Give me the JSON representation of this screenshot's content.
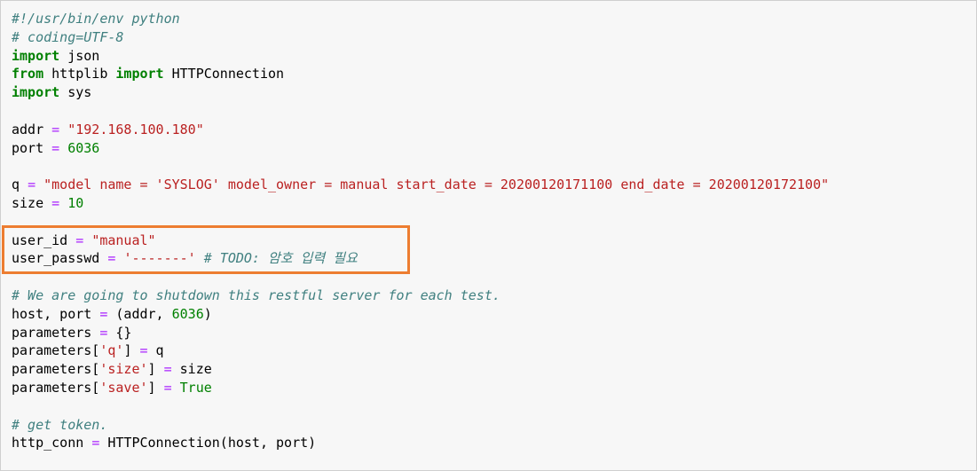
{
  "highlight": {
    "color": "#ed7d31",
    "lines": [
      11,
      12
    ]
  },
  "code": {
    "l1": {
      "c": "#!/usr/bin/env python"
    },
    "l2": {
      "c": "# coding=UTF-8"
    },
    "l3": {
      "k": "import",
      "t": " json"
    },
    "l4": {
      "k1": "from",
      "t1": " httplib ",
      "k2": "import",
      "t2": " HTTPConnection"
    },
    "l5": {
      "k": "import",
      "t": " sys"
    },
    "l7": {
      "t": "addr ",
      "o": "=",
      "sp": " ",
      "s": "\"192.168.100.180\""
    },
    "l8": {
      "t": "port ",
      "o": "=",
      "sp": " ",
      "n": "6036"
    },
    "l10": {
      "t": "q ",
      "o": "=",
      "sp": " ",
      "s": "\"model name = 'SYSLOG' model_owner = manual start_date = 20200120171100 end_date = 20200120172100\""
    },
    "l11": {
      "t": "size ",
      "o": "=",
      "sp": " ",
      "n": "10"
    },
    "l13": {
      "t": "user_id ",
      "o": "=",
      "sp": " ",
      "s": "\"manual\""
    },
    "l14": {
      "t": "user_passwd ",
      "o": "=",
      "sp": " ",
      "s": "'-------'",
      "sp2": " ",
      "c": "# TODO: 암호 입력 필요"
    },
    "l16": {
      "c": "# We are going to shutdown this restful server for each test."
    },
    "l17": {
      "t": "host, port ",
      "o": "=",
      "t2": " (addr, ",
      "n": "6036",
      "t3": ")"
    },
    "l18": {
      "t": "parameters ",
      "o": "=",
      "t2": " {}"
    },
    "l19": {
      "t": "parameters[",
      "s": "'q'",
      "t2": "] ",
      "o": "=",
      "t3": " q"
    },
    "l20": {
      "t": "parameters[",
      "s": "'size'",
      "t2": "] ",
      "o": "=",
      "t3": " size"
    },
    "l21": {
      "t": "parameters[",
      "s": "'save'",
      "t2": "] ",
      "o": "=",
      "sp": " ",
      "n": "True"
    },
    "l23": {
      "c": "# get token."
    },
    "l24": {
      "t": "http_conn ",
      "o": "=",
      "t2": " HTTPConnection(host, port)"
    }
  }
}
